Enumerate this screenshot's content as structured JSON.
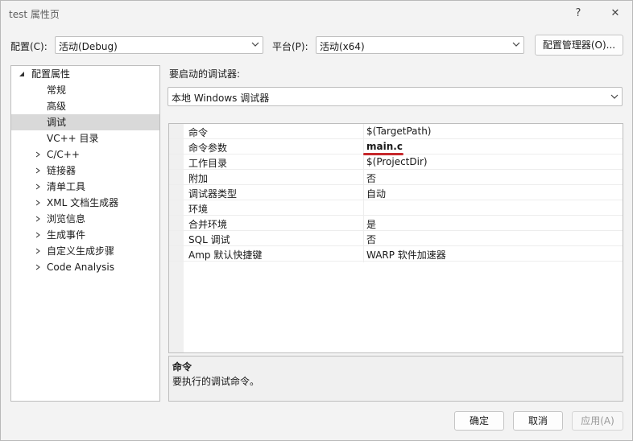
{
  "window": {
    "title": "test 属性页",
    "help_glyph": "?",
    "close_glyph": "✕"
  },
  "toolbar": {
    "config_label": "配置(C):",
    "config_value": "活动(Debug)",
    "platform_label": "平台(P):",
    "platform_value": "活动(x64)",
    "config_manager_button": "配置管理器(O)..."
  },
  "tree": {
    "root": "配置属性",
    "items": [
      {
        "label": "常规"
      },
      {
        "label": "高级"
      },
      {
        "label": "调试"
      },
      {
        "label": "VC++ 目录"
      },
      {
        "label": "C/C++"
      },
      {
        "label": "链接器"
      },
      {
        "label": "清单工具"
      },
      {
        "label": "XML 文档生成器"
      },
      {
        "label": "浏览信息"
      },
      {
        "label": "生成事件"
      },
      {
        "label": "自定义生成步骤"
      },
      {
        "label": "Code Analysis"
      }
    ],
    "selected": "调试"
  },
  "debugger": {
    "label": "要启动的调试器:",
    "value": "本地 Windows 调试器"
  },
  "properties": [
    {
      "name": "命令",
      "value": "$(TargetPath)"
    },
    {
      "name": "命令参数",
      "value": "main.c"
    },
    {
      "name": "工作目录",
      "value": "$(ProjectDir)"
    },
    {
      "name": "附加",
      "value": "否"
    },
    {
      "name": "调试器类型",
      "value": "自动"
    },
    {
      "name": "环境",
      "value": ""
    },
    {
      "name": "合并环境",
      "value": "是"
    },
    {
      "name": "SQL 调试",
      "value": "否"
    },
    {
      "name": "Amp 默认快捷键",
      "value": "WARP 软件加速器"
    }
  ],
  "description": {
    "title": "命令",
    "text": "要执行的调试命令。"
  },
  "buttons": {
    "ok": "确定",
    "cancel": "取消",
    "apply": "应用(A)"
  },
  "colors": {
    "accent_underline": "#c6282c",
    "selection": "#d9d9d9"
  }
}
